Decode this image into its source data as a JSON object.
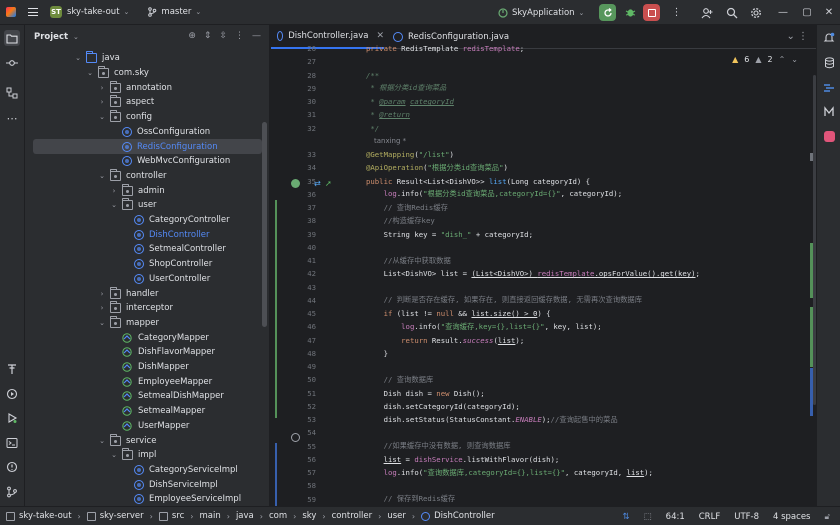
{
  "titlebar": {
    "project_badge": "ST",
    "project_name": "sky-take-out",
    "branch": "master",
    "run_config": "SkyApplication"
  },
  "project_panel": {
    "title": "Project",
    "tree": [
      {
        "label": "java",
        "kind": "source-folder",
        "depth": 0,
        "open": true
      },
      {
        "label": "com.sky",
        "kind": "package",
        "depth": 1,
        "open": true
      },
      {
        "label": "annotation",
        "kind": "package",
        "depth": 2,
        "open": false
      },
      {
        "label": "aspect",
        "kind": "package",
        "depth": 2,
        "open": false
      },
      {
        "label": "config",
        "kind": "package",
        "depth": 2,
        "open": true
      },
      {
        "label": "OssConfiguration",
        "kind": "class",
        "depth": 3
      },
      {
        "label": "RedisConfiguration",
        "kind": "class",
        "depth": 3,
        "selected": true
      },
      {
        "label": "WebMvcConfiguration",
        "kind": "class",
        "depth": 3
      },
      {
        "label": "controller",
        "kind": "package",
        "depth": 2,
        "open": true
      },
      {
        "label": "admin",
        "kind": "package",
        "depth": 3,
        "open": false
      },
      {
        "label": "user",
        "kind": "package",
        "depth": 3,
        "open": true
      },
      {
        "label": "CategoryController",
        "kind": "class",
        "depth": 4
      },
      {
        "label": "DishController",
        "kind": "class",
        "depth": 4,
        "blue": true
      },
      {
        "label": "SetmealController",
        "kind": "class",
        "depth": 4
      },
      {
        "label": "ShopController",
        "kind": "class",
        "depth": 4
      },
      {
        "label": "UserController",
        "kind": "class",
        "depth": 4
      },
      {
        "label": "handler",
        "kind": "package",
        "depth": 2,
        "open": false
      },
      {
        "label": "interceptor",
        "kind": "package",
        "depth": 2,
        "open": false
      },
      {
        "label": "mapper",
        "kind": "package",
        "depth": 2,
        "open": true
      },
      {
        "label": "CategoryMapper",
        "kind": "mapper",
        "depth": 3
      },
      {
        "label": "DishFlavorMapper",
        "kind": "mapper",
        "depth": 3
      },
      {
        "label": "DishMapper",
        "kind": "mapper",
        "depth": 3
      },
      {
        "label": "EmployeeMapper",
        "kind": "mapper",
        "depth": 3
      },
      {
        "label": "SetmealDishMapper",
        "kind": "mapper",
        "depth": 3
      },
      {
        "label": "SetmealMapper",
        "kind": "mapper",
        "depth": 3
      },
      {
        "label": "UserMapper",
        "kind": "mapper",
        "depth": 3
      },
      {
        "label": "service",
        "kind": "package",
        "depth": 2,
        "open": true
      },
      {
        "label": "impl",
        "kind": "package",
        "depth": 3,
        "open": true
      },
      {
        "label": "CategoryServiceImpl",
        "kind": "class",
        "depth": 4
      },
      {
        "label": "DishServiceImpl",
        "kind": "class",
        "depth": 4
      },
      {
        "label": "EmployeeServiceImpl",
        "kind": "class",
        "depth": 4
      }
    ]
  },
  "editor": {
    "tabs": [
      {
        "label": "DishController.java",
        "active": true
      },
      {
        "label": "RedisConfiguration.java",
        "active": false
      }
    ],
    "inspections": {
      "warnings": "6",
      "weak_warnings": "2"
    },
    "author_hint": "tanxing *",
    "lines": [
      {
        "n": "26",
        "html": "<span class=\"kw\">private</span> RedisTemplate <span class=\"fld\">redisTemplate</span>;"
      },
      {
        "n": "27",
        "html": ""
      },
      {
        "n": "28",
        "html": "<span class=\"jd\">/**</span>"
      },
      {
        "n": "29",
        "html": "<span class=\"jd\"> * 根据分类id查询菜品</span>"
      },
      {
        "n": "30",
        "html": "<span class=\"jd\"> * </span><span class=\"tag\">@param</span><span class=\"jd\"> </span><span class=\"jd ul\">categoryId</span>"
      },
      {
        "n": "31",
        "html": "<span class=\"jd\"> * </span><span class=\"tag\">@return</span>"
      },
      {
        "n": "32",
        "html": "<span class=\"jd\"> */</span>"
      },
      {
        "n": "",
        "hint": true
      },
      {
        "n": "33",
        "html": "<span class=\"ann\">@GetMapping</span>(<span class=\"str\">\"/list\"</span>)"
      },
      {
        "n": "34",
        "html": "<span class=\"ann\">@ApiOperation</span>(<span class=\"str\">\"根据分类id查询菜品\"</span>)"
      },
      {
        "n": "35",
        "html": "<span class=\"kw\">public</span> Result&lt;List&lt;DishVO&gt;&gt; <span class=\"fn\">list</span>(Long categoryId) {"
      },
      {
        "n": "36",
        "html": "    <span class=\"fld\">log</span>.info(<span class=\"str\">\"根据分类id查询菜品,categoryId={}\"</span>, categoryId);"
      },
      {
        "n": "37",
        "html": "    <span class=\"cm\">// 查询Redis缓存</span>"
      },
      {
        "n": "38",
        "html": "    <span class=\"cm\">//构造缓存key</span>"
      },
      {
        "n": "39",
        "html": "    String key = <span class=\"str\">\"dish_\"</span> + categoryId;"
      },
      {
        "n": "40",
        "html": ""
      },
      {
        "n": "41",
        "html": "    <span class=\"cm\">//从缓存中获取数据</span>"
      },
      {
        "n": "42",
        "html": "    List&lt;DishVO&gt; list = <span class=\"ul\">(List&lt;DishVO&gt;) <span class=\"fld\">redisTemplate</span>.opsForValue().get(key)</span>;"
      },
      {
        "n": "43",
        "html": ""
      },
      {
        "n": "44",
        "html": "    <span class=\"cm\">// 判断是否存在缓存, 如果存在, 则直接返回缓存数据, 无需再次查询数据库</span>"
      },
      {
        "n": "45",
        "html": "    <span class=\"kw\">if</span> (list != <span class=\"kw\">null</span> &amp;&amp; <span class=\"ul\">list.size() &gt; 0</span>) {"
      },
      {
        "n": "46",
        "html": "        <span class=\"fld\">log</span>.info(<span class=\"str\">\"查询缓存,key={},list={}\"</span>, key, list);"
      },
      {
        "n": "47",
        "html": "        <span class=\"kw\">return</span> Result.<span class=\"st\">success</span>(<span class=\"ul\">list</span>);"
      },
      {
        "n": "48",
        "html": "    }"
      },
      {
        "n": "49",
        "html": ""
      },
      {
        "n": "50",
        "html": "    <span class=\"cm\">// 查询数据库</span>"
      },
      {
        "n": "51",
        "html": "    Dish dish = <span class=\"kw\">new</span> Dish();"
      },
      {
        "n": "52",
        "html": "    dish.setCategoryId(categoryId);"
      },
      {
        "n": "53",
        "html": "    dish.setStatus(StatusConstant.<span class=\"st\">ENABLE</span>);<span class=\"cm\">//查询起售中的菜品</span>"
      },
      {
        "n": "54",
        "html": ""
      },
      {
        "n": "55",
        "html": "    <span class=\"cm\">//如果缓存中没有数据, 则查询数据库</span>"
      },
      {
        "n": "56",
        "html": "    <span class=\"ul\">list</span> = <span class=\"fld\">dishService</span>.listWithFlavor(dish);"
      },
      {
        "n": "57",
        "html": "    <span class=\"fld\">log</span>.info(<span class=\"str\">\"查询数据库,categoryId={},list={}\"</span>, categoryId, <span class=\"ul\">list</span>);"
      },
      {
        "n": "58",
        "html": ""
      },
      {
        "n": "59",
        "html": "    <span class=\"cm\">// 保存到Redis缓存</span>"
      }
    ]
  },
  "statusbar": {
    "breadcrumb": [
      "sky-take-out",
      "sky-server",
      "src",
      "main",
      "java",
      "com",
      "sky",
      "controller",
      "user",
      "DishController"
    ],
    "position": "64:1",
    "line_sep": "CRLF",
    "encoding": "UTF-8",
    "indent": "4 spaces"
  }
}
